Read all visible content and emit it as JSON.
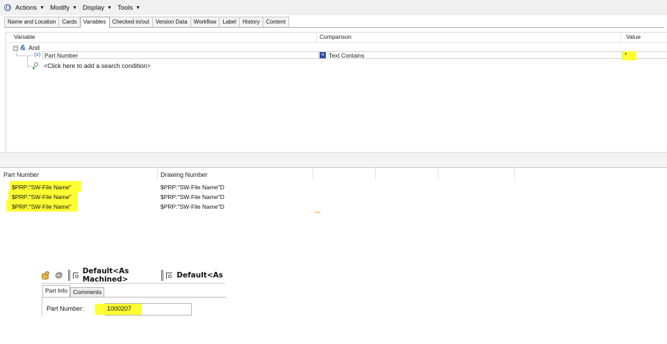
{
  "menu": {
    "items": [
      {
        "label": "Actions",
        "icon": "globe-icon"
      },
      {
        "label": "Modify"
      },
      {
        "label": "Display"
      },
      {
        "label": "Tools"
      }
    ]
  },
  "tabs": {
    "items": [
      "Name and Location",
      "Cards",
      "Variables",
      "Checked in/out",
      "Version Data",
      "Workflow",
      "Label",
      "History",
      "Content"
    ],
    "active": "Variables"
  },
  "search_grid": {
    "headers": {
      "variable": "Variable",
      "comparison": "Comparison",
      "value": "Value"
    },
    "group_operator": "And",
    "condition": {
      "variable_icon": "(x)",
      "variable": "Part Number",
      "comparison_icon": "a",
      "comparison": "Text Contains",
      "value": "*"
    },
    "add_condition": "<Click here to add a search condition>"
  },
  "results": {
    "headers": {
      "part_number": "Part Number",
      "drawing_number": "Drawing Number"
    },
    "rows": [
      {
        "part_number": "$PRP:\"SW-File Name\"",
        "drawing_number": "$PRP:\"SW-File Name\"D"
      },
      {
        "part_number": "$PRP:\"SW-File Name\"",
        "drawing_number": "$PRP:\"SW-File Name\"D"
      },
      {
        "part_number": "$PRP:\"SW-File Name\"",
        "drawing_number": "$PRP:\"SW-File Name\"D"
      }
    ],
    "highlight_color": "#ffff33"
  },
  "property_panel": {
    "at_symbol": "@",
    "config_tabs": [
      "Default<As Machined>",
      "Default<As"
    ],
    "tabs": [
      "Part Info",
      "Comments"
    ],
    "active_tab": "Part Info",
    "part_number_label": "Part Number:",
    "part_number_value": "1000207"
  },
  "colors": {
    "accent": "#2c4ea6",
    "highlight": "#ffff33",
    "menubar": "#f0f0f0"
  }
}
